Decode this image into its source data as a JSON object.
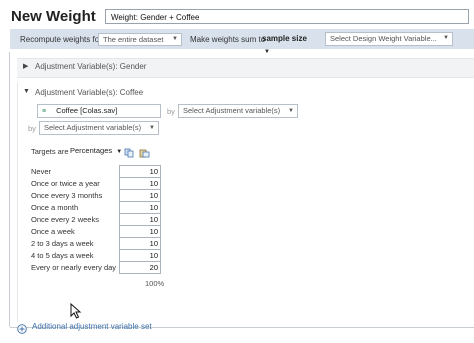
{
  "header": {
    "title": "New Weight",
    "name_value": "Weight: Gender + Coffee"
  },
  "toolbar": {
    "recompute_label": "Recompute weights for",
    "recompute_value": "The entire dataset",
    "sum_label": "Make weights sum to",
    "sum_value": "sample size",
    "design_placeholder": "Select Design Weight Variable..."
  },
  "sections": {
    "gender_label": "Adjustment Variable(s): Gender",
    "coffee_label": "Adjustment Variable(s): Coffee"
  },
  "coffee": {
    "variable_value": "Coffee [Colas.sav]",
    "by_label": "by",
    "by_placeholder": "Select Adjustment variable(s)",
    "by2_label": "by",
    "by2_placeholder": "Select Adjustment variable(s)",
    "targets_label": "Targets are",
    "targets_mode": "Percentages",
    "rows": [
      {
        "label": "Never",
        "value": "10"
      },
      {
        "label": "Once or twice a year",
        "value": "10"
      },
      {
        "label": "Once every 3 months",
        "value": "10"
      },
      {
        "label": "Once a month",
        "value": "10"
      },
      {
        "label": "Once every 2 weeks",
        "value": "10"
      },
      {
        "label": "Once a week",
        "value": "10"
      },
      {
        "label": "2 to 3 days a week",
        "value": "10"
      },
      {
        "label": "4 to 5 days a week",
        "value": "10"
      },
      {
        "label": "Every or nearly every day",
        "value": "20"
      }
    ],
    "total": "100%"
  },
  "footer": {
    "add_label": "Additional adjustment variable set"
  },
  "colors": {
    "toolbar_bg": "#d9e2ec",
    "link": "#3b6ea8"
  }
}
